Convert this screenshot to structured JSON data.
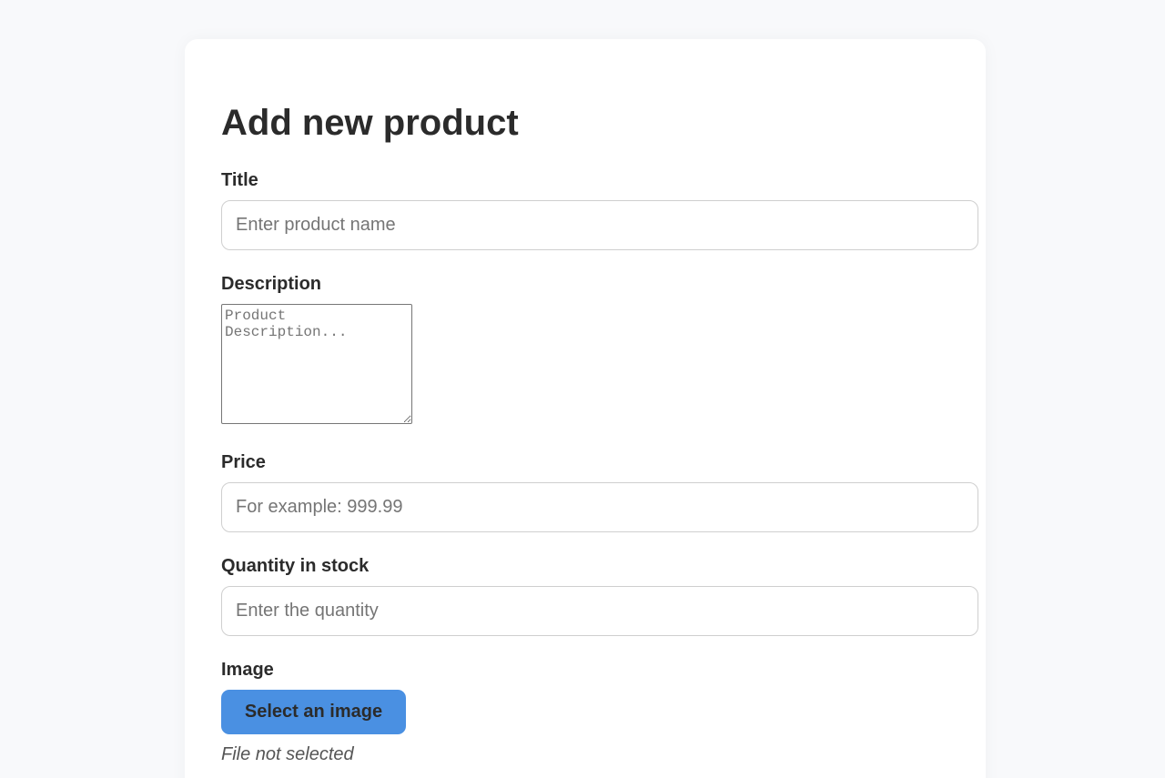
{
  "form": {
    "heading": "Add new product",
    "title_field": {
      "label": "Title",
      "placeholder": "Enter product name",
      "value": ""
    },
    "description_field": {
      "label": "Description",
      "placeholder": "Product Description...",
      "value": ""
    },
    "price_field": {
      "label": "Price",
      "placeholder": "For example: 999.99",
      "value": ""
    },
    "quantity_field": {
      "label": "Quantity in stock",
      "placeholder": "Enter the quantity",
      "value": ""
    },
    "image_field": {
      "label": "Image",
      "button_label": "Select an image",
      "status": "File not selected"
    }
  },
  "colors": {
    "page_background": "#f8f9fb",
    "card_background": "#ffffff",
    "accent": "#4a90e2",
    "text": "#2b2b2b",
    "muted_text": "#555555"
  }
}
